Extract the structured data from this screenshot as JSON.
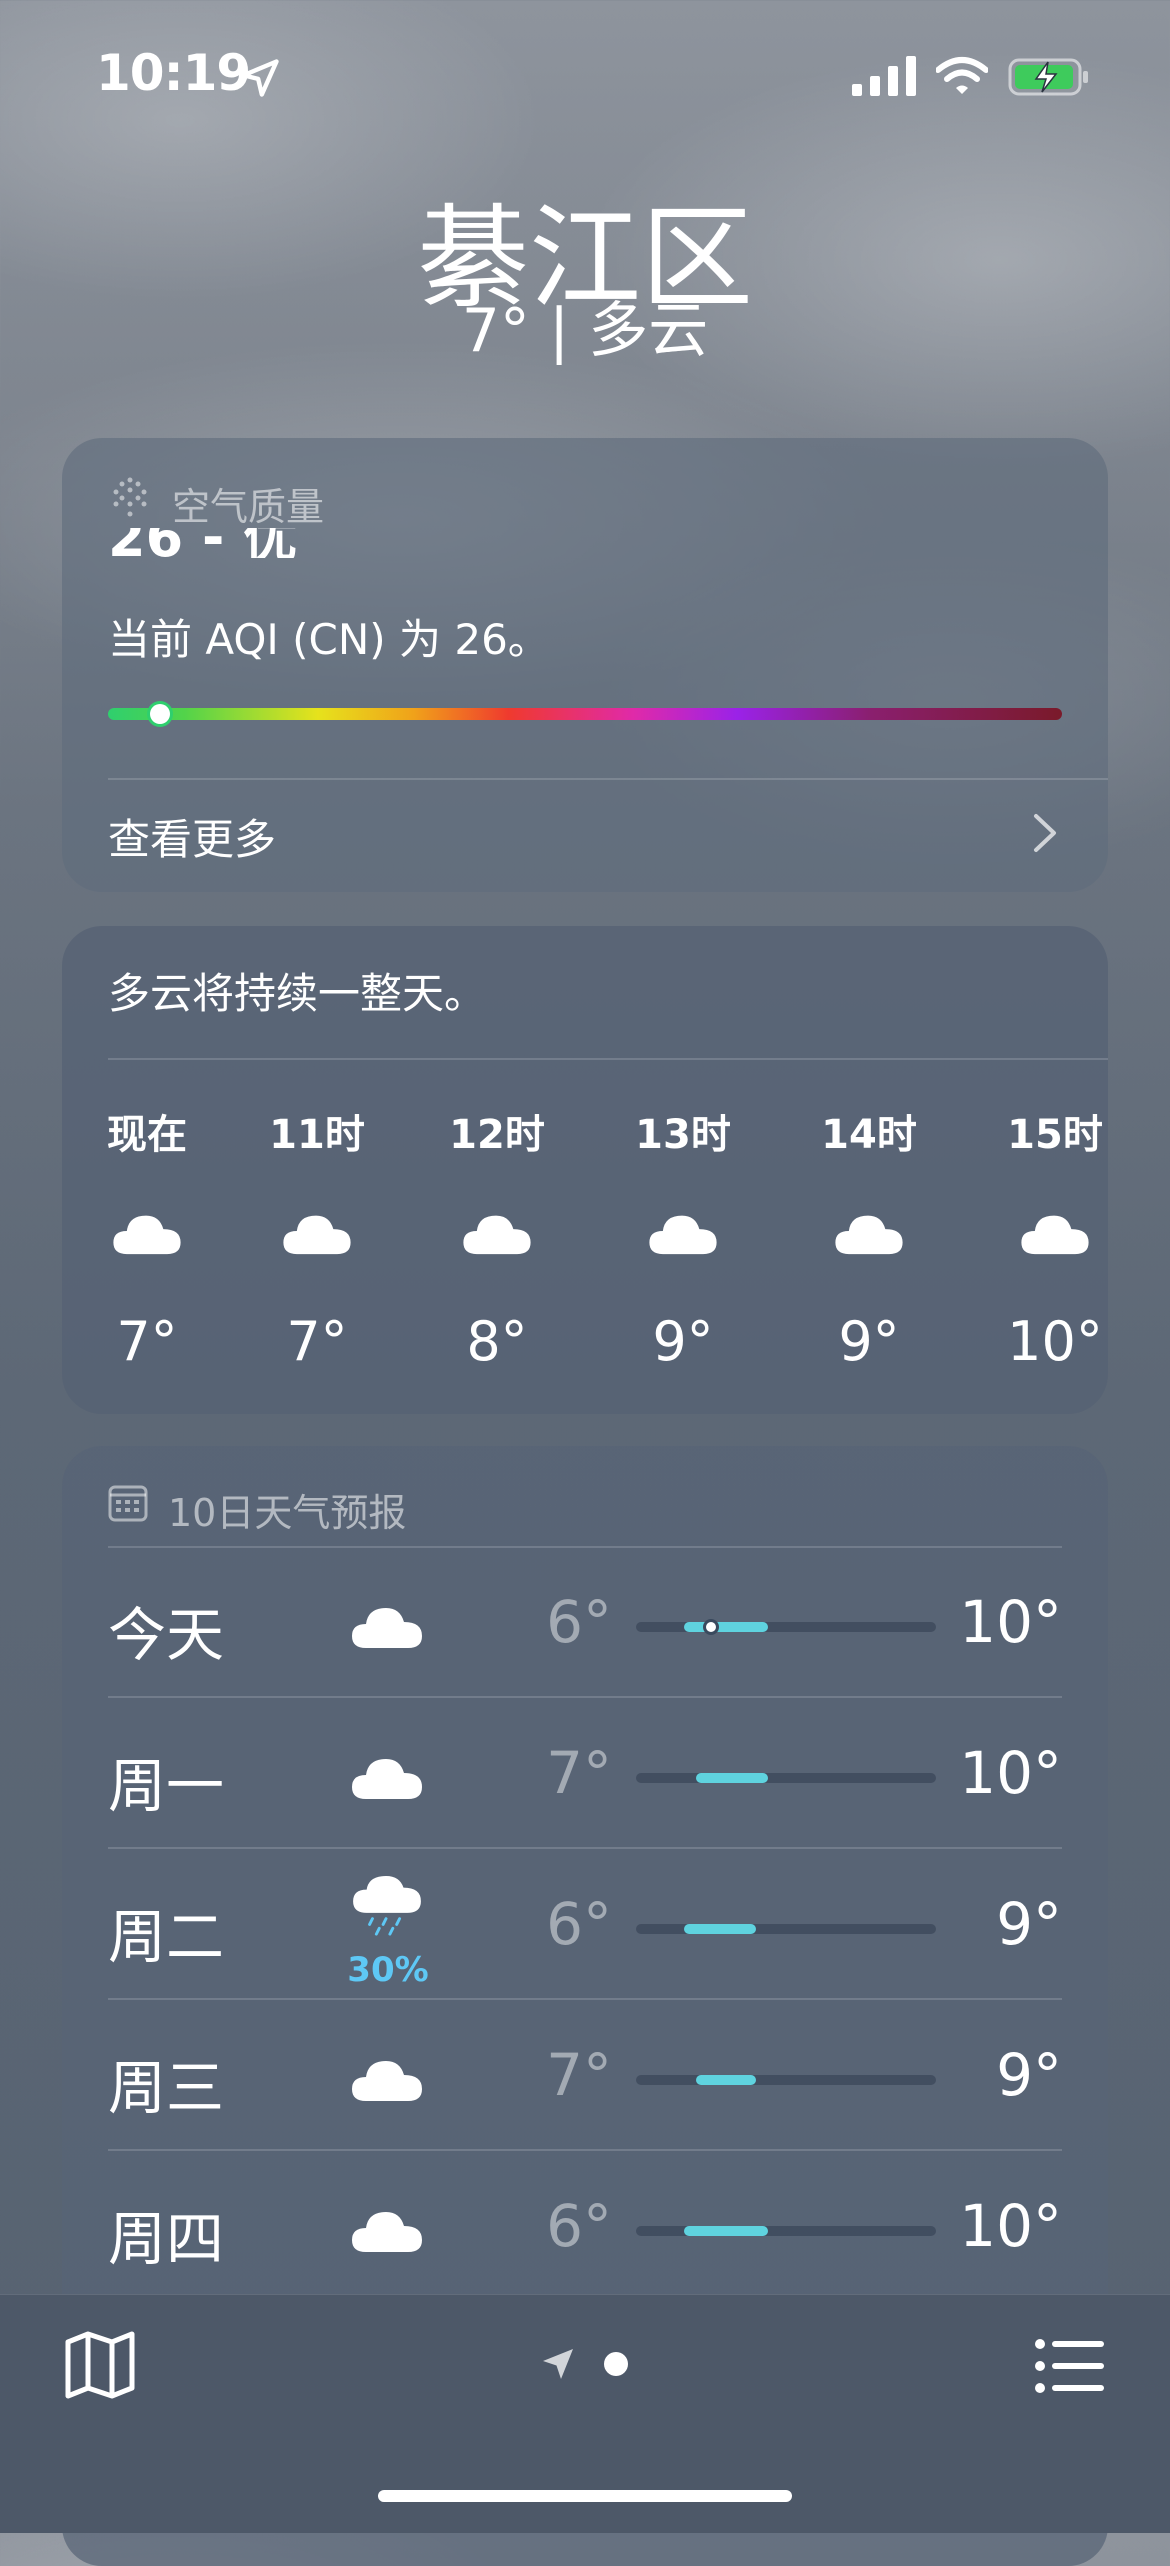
{
  "status": {
    "time": "10:19"
  },
  "header": {
    "city": "綦江区",
    "condition": "7° | 多云"
  },
  "aqi": {
    "label": "空气质量",
    "value_partial": "26 - 优",
    "description": "当前 AQI (CN) 为 26。",
    "index_fraction": 0.055,
    "more": "查看更多"
  },
  "hourly": {
    "summary": "多云将持续一整天。",
    "items": [
      {
        "time": "现在",
        "icon": "cloud-icon",
        "temp": "7°"
      },
      {
        "time": "11时",
        "icon": "cloud-icon",
        "temp": "7°"
      },
      {
        "time": "12时",
        "icon": "cloud-icon",
        "temp": "8°"
      },
      {
        "time": "13时",
        "icon": "cloud-icon",
        "temp": "9°"
      },
      {
        "time": "14时",
        "icon": "cloud-icon",
        "temp": "9°"
      },
      {
        "time": "15时",
        "icon": "cloud-icon",
        "temp": "10°"
      }
    ]
  },
  "forecast": {
    "label": "10日天气预报",
    "days": [
      {
        "day": "今天",
        "icon": "cloud-icon",
        "pop": "",
        "low": "6°",
        "high": "10°",
        "range_start": 0.16,
        "range_end": 0.44,
        "current": 0.25
      },
      {
        "day": "周一",
        "icon": "cloud-icon",
        "pop": "",
        "low": "7°",
        "high": "10°",
        "range_start": 0.2,
        "range_end": 0.44,
        "current": null
      },
      {
        "day": "周二",
        "icon": "rain-cloud-icon",
        "pop": "30%",
        "low": "6°",
        "high": "9°",
        "range_start": 0.16,
        "range_end": 0.4,
        "current": null
      },
      {
        "day": "周三",
        "icon": "cloud-icon",
        "pop": "",
        "low": "7°",
        "high": "9°",
        "range_start": 0.2,
        "range_end": 0.4,
        "current": null
      },
      {
        "day": "周四",
        "icon": "cloud-icon",
        "pop": "",
        "low": "6°",
        "high": "10°",
        "range_start": 0.16,
        "range_end": 0.44,
        "current": null
      }
    ]
  },
  "colors": {
    "aqi_good": "#2fcf6e",
    "range_bar": "#5fd3df",
    "precip": "#5ec8f5"
  }
}
